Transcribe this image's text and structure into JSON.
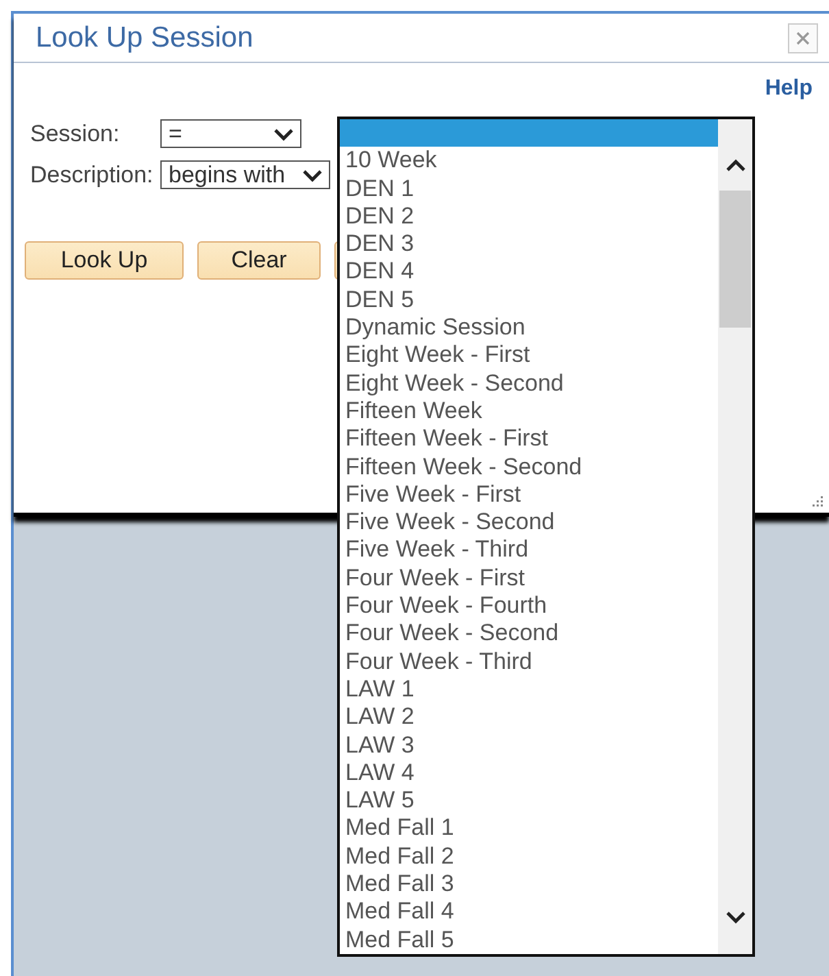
{
  "dialog": {
    "title": "Look Up Session",
    "help": "Help"
  },
  "criteria": [
    {
      "label": "Session:",
      "operator": "="
    },
    {
      "label": "Description:",
      "operator": "begins with"
    }
  ],
  "buttons": [
    {
      "label": "Look Up"
    },
    {
      "label": "Clear"
    }
  ],
  "dropdown": {
    "options": [
      {
        "selected": true
      },
      {
        "label": "10 Week",
        "selected": false
      },
      {
        "label": "DEN 1",
        "selected": false
      },
      {
        "label": "DEN 2",
        "selected": false
      },
      {
        "label": "DEN 3",
        "selected": false
      },
      {
        "label": "DEN 4",
        "selected": false
      },
      {
        "label": "DEN 5",
        "selected": false
      },
      {
        "label": "Dynamic Session",
        "selected": false
      },
      {
        "label": "Eight Week - First",
        "selected": false
      },
      {
        "label": "Eight Week - Second",
        "selected": false
      },
      {
        "label": "Fifteen Week",
        "selected": false
      },
      {
        "label": "Fifteen Week - First",
        "selected": false
      },
      {
        "label": "Fifteen Week - Second",
        "selected": false
      },
      {
        "label": "Five Week - First",
        "selected": false
      },
      {
        "label": "Five Week - Second",
        "selected": false
      },
      {
        "label": "Five Week - Third",
        "selected": false
      },
      {
        "label": "Four Week - First",
        "selected": false
      },
      {
        "label": "Four Week - Fourth",
        "selected": false
      },
      {
        "label": "Four Week - Second",
        "selected": false
      },
      {
        "label": "Four Week - Third",
        "selected": false
      },
      {
        "label": "LAW 1",
        "selected": false
      },
      {
        "label": "LAW 2",
        "selected": false
      },
      {
        "label": "LAW 3",
        "selected": false
      },
      {
        "label": "LAW 4",
        "selected": false
      },
      {
        "label": "LAW 5",
        "selected": false
      },
      {
        "label": "Med Fall 1",
        "selected": false
      },
      {
        "label": "Med Fall 2",
        "selected": false
      },
      {
        "label": "Med Fall 3",
        "selected": false
      },
      {
        "label": "Med Fall 4",
        "selected": false
      },
      {
        "label": "Med Fall 5",
        "selected": false
      }
    ]
  }
}
